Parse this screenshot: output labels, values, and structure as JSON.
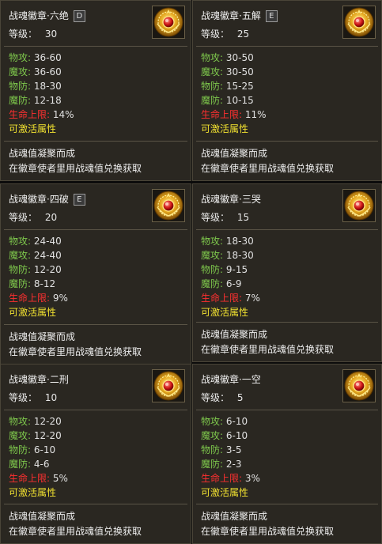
{
  "cards": [
    {
      "title": "战魂徽章·六绝",
      "grade": "D",
      "level_label": "等级：",
      "level": "30",
      "stats": [
        {
          "k": "物攻:",
          "v": "36-60"
        },
        {
          "k": "魔攻:",
          "v": "36-60"
        },
        {
          "k": "物防:",
          "v": "18-30"
        },
        {
          "k": "魔防:",
          "v": "12-18"
        },
        {
          "k": "生命上限:",
          "v": "14%"
        }
      ],
      "activatable": "可激活属性",
      "desc1": "战魂值凝聚而成",
      "desc2": "在徽章使者里用战魂值兑换获取"
    },
    {
      "title": "战魂徽章·五解",
      "grade": "E",
      "level_label": "等级：",
      "level": "25",
      "stats": [
        {
          "k": "物攻:",
          "v": "30-50"
        },
        {
          "k": "魔攻:",
          "v": "30-50"
        },
        {
          "k": "物防:",
          "v": "15-25"
        },
        {
          "k": "魔防:",
          "v": "10-15"
        },
        {
          "k": "生命上限:",
          "v": "11%"
        }
      ],
      "activatable": "可激活属性",
      "desc1": "战魂值凝聚而成",
      "desc2": "在徽章使者里用战魂值兑换获取"
    },
    {
      "title": "战魂徽章·四破",
      "grade": "E",
      "level_label": "等级：",
      "level": "20",
      "stats": [
        {
          "k": "物攻:",
          "v": "24-40"
        },
        {
          "k": "魔攻:",
          "v": "24-40"
        },
        {
          "k": "物防:",
          "v": "12-20"
        },
        {
          "k": "魔防:",
          "v": "8-12"
        },
        {
          "k": "生命上限:",
          "v": "9%"
        }
      ],
      "activatable": "可激活属性",
      "desc1": "战魂值凝聚而成",
      "desc2": "在徽章使者里用战魂值兑换获取"
    },
    {
      "title": "战魂徽章·三哭",
      "grade": "",
      "level_label": "等级：",
      "level": "15",
      "stats": [
        {
          "k": "物攻:",
          "v": "18-30"
        },
        {
          "k": "魔攻:",
          "v": "18-30"
        },
        {
          "k": "物防:",
          "v": "9-15"
        },
        {
          "k": "魔防:",
          "v": "6-9"
        },
        {
          "k": "生命上限:",
          "v": "7%"
        }
      ],
      "activatable": "可激活属性",
      "desc1": "战魂值凝聚而成",
      "desc2": "在徽章使者里用战魂值兑换获取"
    },
    {
      "title": "战魂徽章·二刑",
      "grade": "",
      "level_label": "等级：",
      "level": "10",
      "stats": [
        {
          "k": "物攻:",
          "v": "12-20"
        },
        {
          "k": "魔攻:",
          "v": "12-20"
        },
        {
          "k": "物防:",
          "v": "6-10"
        },
        {
          "k": "魔防:",
          "v": "4-6"
        },
        {
          "k": "生命上限:",
          "v": "5%"
        }
      ],
      "activatable": "可激活属性",
      "desc1": "战魂值凝聚而成",
      "desc2": "在徽章使者里用战魂值兑换获取"
    },
    {
      "title": "战魂徽章·一空",
      "grade": "",
      "level_label": "等级：",
      "level": "5",
      "stats": [
        {
          "k": "物攻:",
          "v": "6-10"
        },
        {
          "k": "魔攻:",
          "v": "6-10"
        },
        {
          "k": "物防:",
          "v": "3-5"
        },
        {
          "k": "魔防:",
          "v": "2-3"
        },
        {
          "k": "生命上限:",
          "v": "3%"
        }
      ],
      "activatable": "可激活属性",
      "desc1": "战魂值凝聚而成",
      "desc2": "在徽章使者里用战魂值兑换获取"
    }
  ],
  "icon": "gold-medal-emblem-icon",
  "colors": {
    "stat_key": "#7ec84c",
    "life_key": "#ff3030",
    "activatable": "#f0e030"
  }
}
